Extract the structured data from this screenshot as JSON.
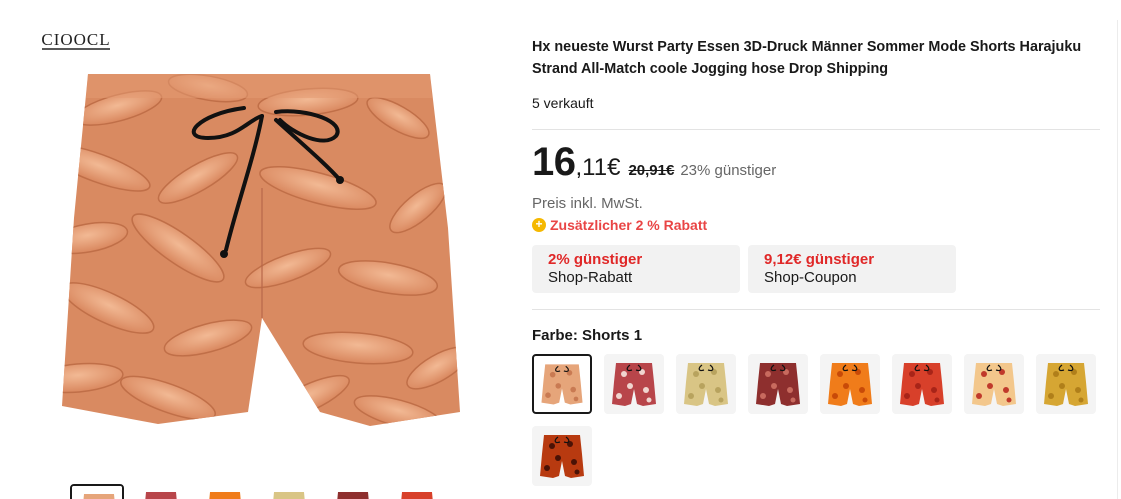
{
  "brand": {
    "logo_text": "CIOOCL"
  },
  "product": {
    "title": "Hx neueste Wurst Party Essen 3D-Druck Männer Sommer Mode Shorts Harajuku Strand All-Match coole Jogging hose Drop Shipping",
    "sold": "5 verkauft"
  },
  "price": {
    "integer": "16",
    "decimal": ",11€",
    "original": "20,91€",
    "discount": "23% günstiger",
    "tax_note": "Preis inkl. MwSt.",
    "extra_discount": "Zusätzlicher 2 % Rabatt"
  },
  "coupons": [
    {
      "value": "2% günstiger",
      "label": "Shop-Rabatt"
    },
    {
      "value": "9,12€ günstiger",
      "label": "Shop-Coupon"
    }
  ],
  "color": {
    "label": "Farbe:",
    "selected": "Shorts 1",
    "options": [
      {
        "name": "sausage",
        "base": "#e6a57a",
        "accent": "#c97a52",
        "selected": true
      },
      {
        "name": "bacon",
        "base": "#b8454a",
        "accent": "#f0d5cf",
        "selected": false
      },
      {
        "name": "cheese",
        "base": "#d9c585",
        "accent": "#b8a35e",
        "selected": false
      },
      {
        "name": "steak",
        "base": "#8e2f2e",
        "accent": "#c86a5e",
        "selected": false
      },
      {
        "name": "orange",
        "base": "#f07c1a",
        "accent": "#c84a08",
        "selected": false
      },
      {
        "name": "chili",
        "base": "#d8402a",
        "accent": "#a82418",
        "selected": false
      },
      {
        "name": "pizza",
        "base": "#f3c78c",
        "accent": "#c0392b",
        "selected": false
      },
      {
        "name": "mustard",
        "base": "#d6a633",
        "accent": "#b07f1a",
        "selected": false
      },
      {
        "name": "barbecue",
        "base": "#b83a10",
        "accent": "#4a1206",
        "selected": false
      }
    ]
  },
  "gallery": {
    "thumbnails": [
      "#e6a57a",
      "#b8454a",
      "#f07c1a",
      "#d9c585",
      "#8e2f2e",
      "#d8402a"
    ]
  }
}
